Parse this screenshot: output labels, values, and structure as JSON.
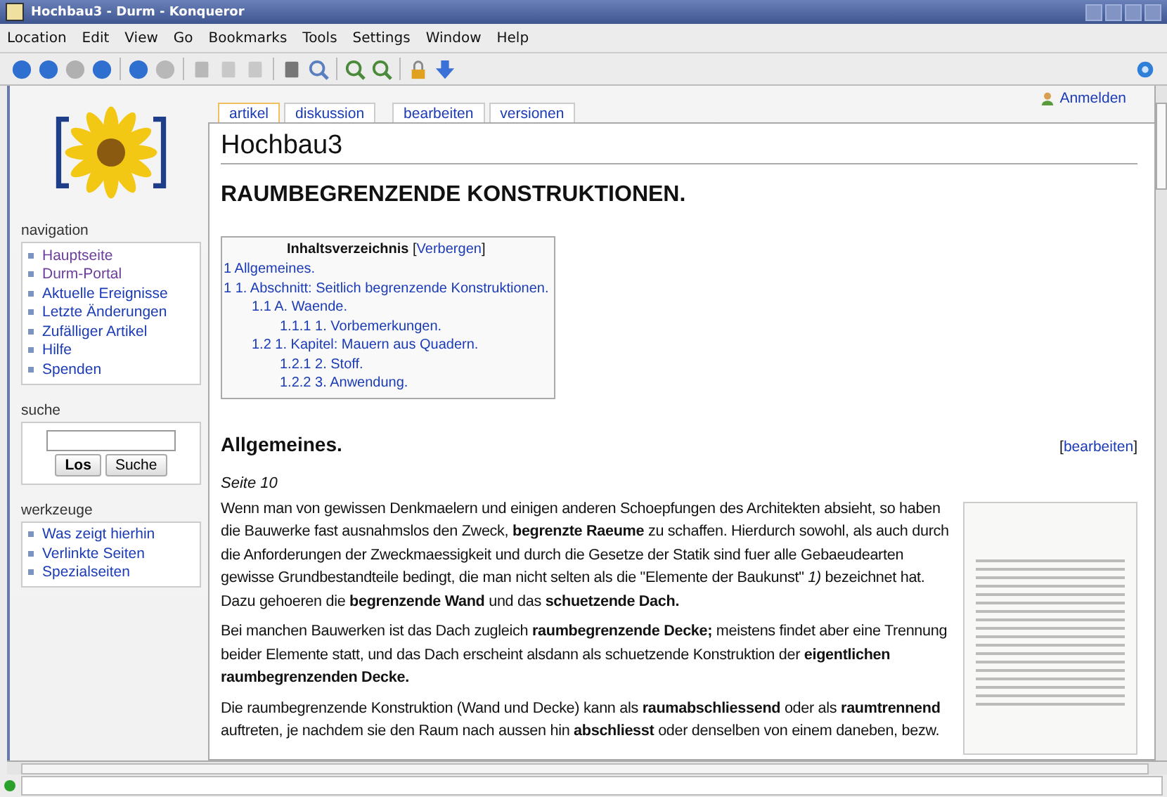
{
  "window": {
    "title": "Hochbau3 - Durm - Konqueror"
  },
  "menu": [
    "Location",
    "Edit",
    "View",
    "Go",
    "Bookmarks",
    "Tools",
    "Settings",
    "Window",
    "Help"
  ],
  "user_link": "Anmelden",
  "sidebar": [
    {
      "title": "navigation",
      "kind": "links",
      "items": [
        {
          "label": "Hauptseite",
          "visited": true
        },
        {
          "label": "Durm-Portal",
          "visited": true
        },
        {
          "label": "Aktuelle Ereignisse",
          "visited": false
        },
        {
          "label": "Letzte Änderungen",
          "visited": false
        },
        {
          "label": "Zufälliger Artikel",
          "visited": false
        },
        {
          "label": "Hilfe",
          "visited": false
        },
        {
          "label": "Spenden",
          "visited": false
        }
      ]
    },
    {
      "title": "suche",
      "kind": "search",
      "buttons": [
        "Los",
        "Suche"
      ]
    },
    {
      "title": "werkzeuge",
      "kind": "links",
      "items": [
        {
          "label": "Was zeigt hierhin",
          "visited": false
        },
        {
          "label": "Verlinkte Seiten",
          "visited": false
        },
        {
          "label": "Spezialseiten",
          "visited": false
        }
      ]
    }
  ],
  "tab_groups": [
    [
      {
        "label": "artikel",
        "selected": true
      },
      {
        "label": "diskussion",
        "selected": false
      }
    ],
    [
      {
        "label": "bearbeiten",
        "selected": false
      },
      {
        "label": "versionen",
        "selected": false
      }
    ]
  ],
  "page": {
    "title": "Hochbau3",
    "heading": "RAUMBEGRENZENDE KONSTRUKTIONEN.",
    "toc": {
      "title": "Inhaltsverzeichnis",
      "toggle_open": "[",
      "toggle": "Verbergen",
      "toggle_close": "]",
      "entries": [
        {
          "number": "1",
          "label": "Allgemeines."
        },
        {
          "number": "1",
          "label": "1. Abschnitt: Seitlich begrenzende Konstruktionen.",
          "children": [
            {
              "number": "1.1",
              "label": "A. Waende.",
              "children": [
                {
                  "number": "1.1.1",
                  "label": "1. Vorbemerkungen."
                }
              ]
            },
            {
              "number": "1.2",
              "label": "1. Kapitel: Mauern aus Quadern.",
              "children": [
                {
                  "number": "1.2.1",
                  "label": "2. Stoff."
                },
                {
                  "number": "1.2.2",
                  "label": "3. Anwendung."
                }
              ]
            }
          ]
        }
      ]
    },
    "section": {
      "title": "Allgemeines.",
      "edit_open": "[",
      "edit_link": "bearbeiten",
      "edit_close": "]",
      "page_note": "Seite 10",
      "paragraphs": [
        "Wenn man von gewissen Denkmaelern und einigen anderen Schoepfungen des Architekten absieht, so haben die Bauwerke fast ausnahmslos den Zweck, **begrenzte Raeume** zu schaffen. Hierdurch sowohl, als auch durch die Anforderungen der Zweckmaessigkeit und durch die Gesetze der Statik sind fuer alle Gebaeudearten gewisse Grundbestandteile bedingt, die man nicht selten als die \"Elemente der Baukunst\" *1)* bezeichnet hat. Dazu gehoeren die **begrenzende Wand** und das **schuetzende Dach.**",
        "Bei manchen Bauwerken ist das Dach zugleich **raumbegrenzende Decke;** meistens findet aber eine Trennung beider Elemente statt, und das Dach erscheint alsdann als schuetzende Konstruktion der **eigentlichen raumbegrenzenden Decke.**",
        "Die raumbegrenzende Konstruktion (Wand und Decke) kann als **raumabschliessend** oder als **raumtrennend** auftreten, je nachdem sie den Raum nach aussen hin **abschliesst** oder denselben von einem daneben, bezw."
      ]
    }
  }
}
